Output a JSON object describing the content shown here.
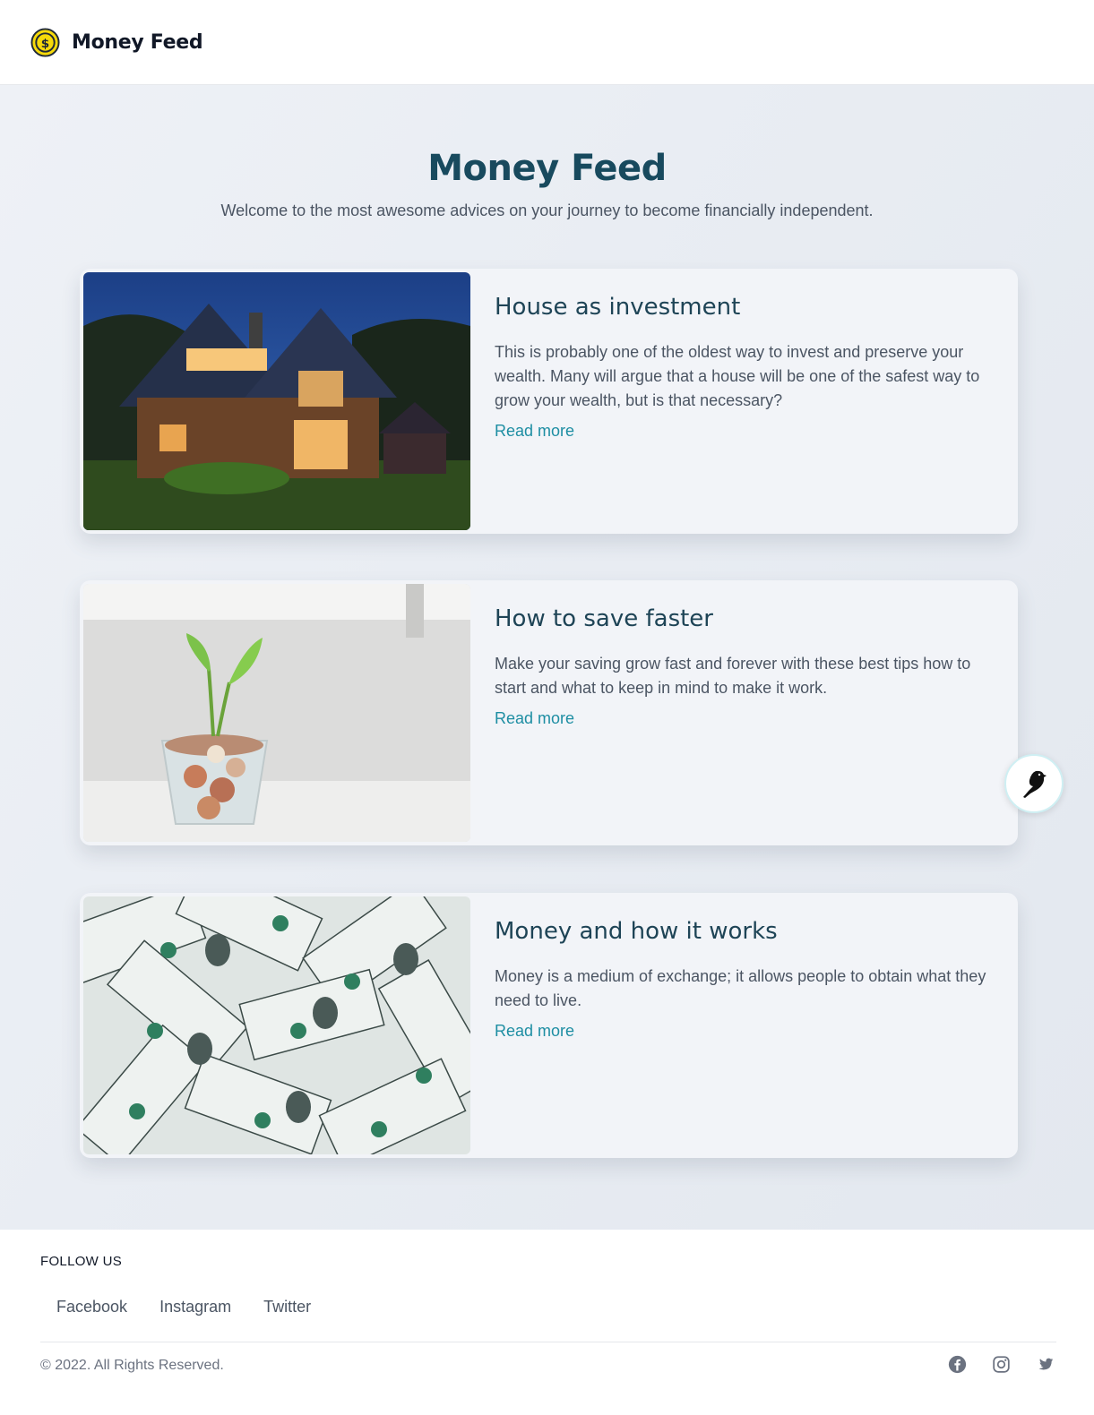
{
  "nav": {
    "brand": "Money Feed",
    "logo_icon": "dollar-coin-icon",
    "logo_color": "#f5d90a"
  },
  "hero": {
    "title": "Money Feed",
    "subtitle": "Welcome to the most awesome advices on your journey to become financially independent."
  },
  "cards": [
    {
      "image": "house-photo",
      "title": "House as investment",
      "text": "This is probably one of the oldest way to invest and preserve your wealth. Many will argue that a house will be one of the safest way to grow your wealth, but is that necessary?",
      "link": "Read more"
    },
    {
      "image": "plant-coins-photo",
      "title": "How to save faster",
      "text": "Make your saving grow fast and forever with these best tips how to start and what to keep in mind to make it work.",
      "link": "Read more"
    },
    {
      "image": "dollar-bills-photo",
      "title": "Money and how it works",
      "text": "Money is a medium of exchange; it allows people to obtain what they need to live.",
      "link": "Read more"
    }
  ],
  "fab": {
    "icon": "bird-icon"
  },
  "footer": {
    "follow_label": "FOLLOW US",
    "links": [
      "Facebook",
      "Instagram",
      "Twitter"
    ],
    "copyright": "© 2022. All Rights Reserved.",
    "icons": [
      "facebook-icon",
      "instagram-icon",
      "twitter-icon"
    ]
  },
  "colors": {
    "accent": "#1e8ea3",
    "title": "#184a5e"
  }
}
